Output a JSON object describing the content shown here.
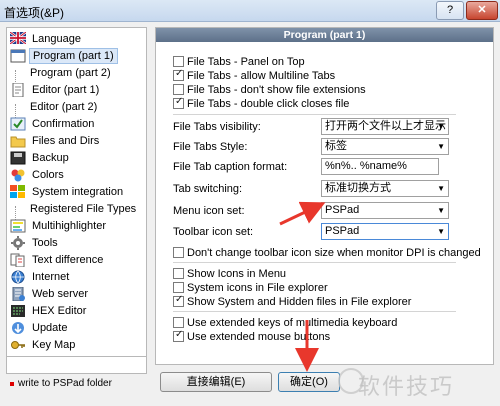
{
  "window": {
    "title": "首选项(&P)",
    "help_label": "?",
    "close_label": "✕"
  },
  "tree": {
    "items": [
      {
        "label": "Language",
        "icon": "language-icon"
      },
      {
        "label": "Program  (part 1)",
        "icon": "program-window-icon"
      },
      {
        "label": "Program  (part 2)",
        "icon": ""
      },
      {
        "label": "Editor  (part 1)",
        "icon": "editor-document-icon"
      },
      {
        "label": "Editor  (part 2)",
        "icon": ""
      },
      {
        "label": "Confirmation",
        "icon": "confirmation-icon"
      },
      {
        "label": "Files and Dirs",
        "icon": "folder-icon"
      },
      {
        "label": "Backup",
        "icon": "backup-icon"
      },
      {
        "label": "Colors",
        "icon": "colors-palette-icon"
      },
      {
        "label": "System integration",
        "icon": "system-integration-icon"
      },
      {
        "label": "Registered File Types",
        "icon": ""
      },
      {
        "label": "Multihighlighter",
        "icon": "multihighlighter-icon"
      },
      {
        "label": "Tools",
        "icon": "tools-gear-icon"
      },
      {
        "label": "Text difference",
        "icon": "text-difference-icon"
      },
      {
        "label": "Internet",
        "icon": "internet-globe-icon"
      },
      {
        "label": "Web server",
        "icon": "web-server-icon"
      },
      {
        "label": "HEX Editor",
        "icon": "hex-editor-icon"
      },
      {
        "label": "Update",
        "icon": "update-icon"
      },
      {
        "label": "Key Map",
        "icon": "key-map-icon"
      }
    ],
    "selected": "Program  (part 1)",
    "footer_note": "write to PSPad folder"
  },
  "panel": {
    "header": "Program (part 1)",
    "checkboxes_top": [
      {
        "label": "File Tabs - Panel on Top",
        "checked": false
      },
      {
        "label": "File Tabs - allow Multiline Tabs",
        "checked": true
      },
      {
        "label": "File Tabs - don't show file extensions",
        "checked": false
      },
      {
        "label": "File Tabs - double click closes file",
        "checked": true
      }
    ],
    "fields": {
      "tabs_visibility": {
        "label": "File Tabs visibility:",
        "value": "打开两个文件以上才显示"
      },
      "tabs_style": {
        "label": "File Tabs Style:",
        "value": "标签"
      },
      "caption_format": {
        "label": "File Tab caption format:",
        "value": "%n%.. %name%"
      },
      "tab_switching": {
        "label": "Tab switching:",
        "value": "标准切换方式"
      },
      "menu_icon_set": {
        "label": "Menu icon set:",
        "value": "PSPad"
      },
      "toolbar_icon_set": {
        "label": "Toolbar icon set:",
        "value": "PSPad"
      }
    },
    "dpi_checkbox": {
      "label": "Don't change toolbar icon size when monitor DPI is changed",
      "checked": false
    },
    "checkboxes_middle": [
      {
        "label": "Show Icons in Menu",
        "checked": false
      },
      {
        "label": "System icons in File explorer",
        "checked": false
      },
      {
        "label": "Show System and Hidden files in File explorer",
        "checked": true
      }
    ],
    "checkboxes_bottom": [
      {
        "label": "Use extended keys of multimedia keyboard",
        "checked": false
      },
      {
        "label": "Use extended mouse buttons",
        "checked": true
      }
    ]
  },
  "buttons": {
    "edit_label": "直接编辑(E)",
    "ok_label": "确定(O)"
  },
  "watermark": "软件技巧",
  "colors": {
    "header_bg": "#5d7089",
    "annotation_arrow": "#e8372c"
  }
}
